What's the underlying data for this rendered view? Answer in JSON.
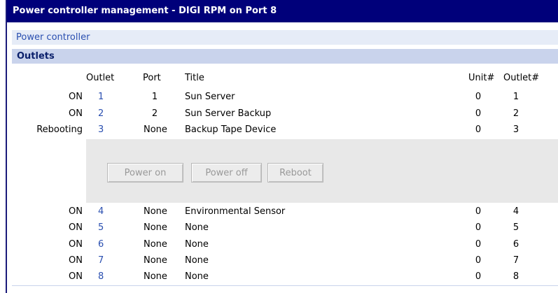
{
  "window": {
    "title": "Power controller management - DIGI RPM on Port 8"
  },
  "sections": {
    "power_controller": "Power controller",
    "outlets": "Outlets"
  },
  "table": {
    "headers": {
      "outlet": "Outlet",
      "port": "Port",
      "title": "Title",
      "unit": "Unit#",
      "outlet_num": "Outlet#"
    },
    "rows": [
      {
        "status": "ON",
        "outlet": "1",
        "port": "1",
        "title": "Sun Server",
        "unit": "0",
        "outlet_num": "1"
      },
      {
        "status": "ON",
        "outlet": "2",
        "port": "2",
        "title": "Sun Server Backup",
        "unit": "0",
        "outlet_num": "2"
      },
      {
        "status": "Rebooting",
        "outlet": "3",
        "port": "None",
        "title": "Backup Tape Device",
        "unit": "0",
        "outlet_num": "3"
      },
      {
        "status": "ON",
        "outlet": "4",
        "port": "None",
        "title": "Environmental Sensor",
        "unit": "0",
        "outlet_num": "4"
      },
      {
        "status": "ON",
        "outlet": "5",
        "port": "None",
        "title": "None",
        "unit": "0",
        "outlet_num": "5"
      },
      {
        "status": "ON",
        "outlet": "6",
        "port": "None",
        "title": "None",
        "unit": "0",
        "outlet_num": "6"
      },
      {
        "status": "ON",
        "outlet": "7",
        "port": "None",
        "title": "None",
        "unit": "0",
        "outlet_num": "7"
      },
      {
        "status": "ON",
        "outlet": "8",
        "port": "None",
        "title": "None",
        "unit": "0",
        "outlet_num": "8"
      }
    ]
  },
  "actions": {
    "power_on": "Power on",
    "power_off": "Power off",
    "reboot": "Reboot"
  },
  "colors": {
    "title_bar": "#00007a",
    "link": "#2a4fb0",
    "section_light": "#e6ecf7",
    "section_dark": "#c9d3ec",
    "panel": "#e8e8e8"
  }
}
